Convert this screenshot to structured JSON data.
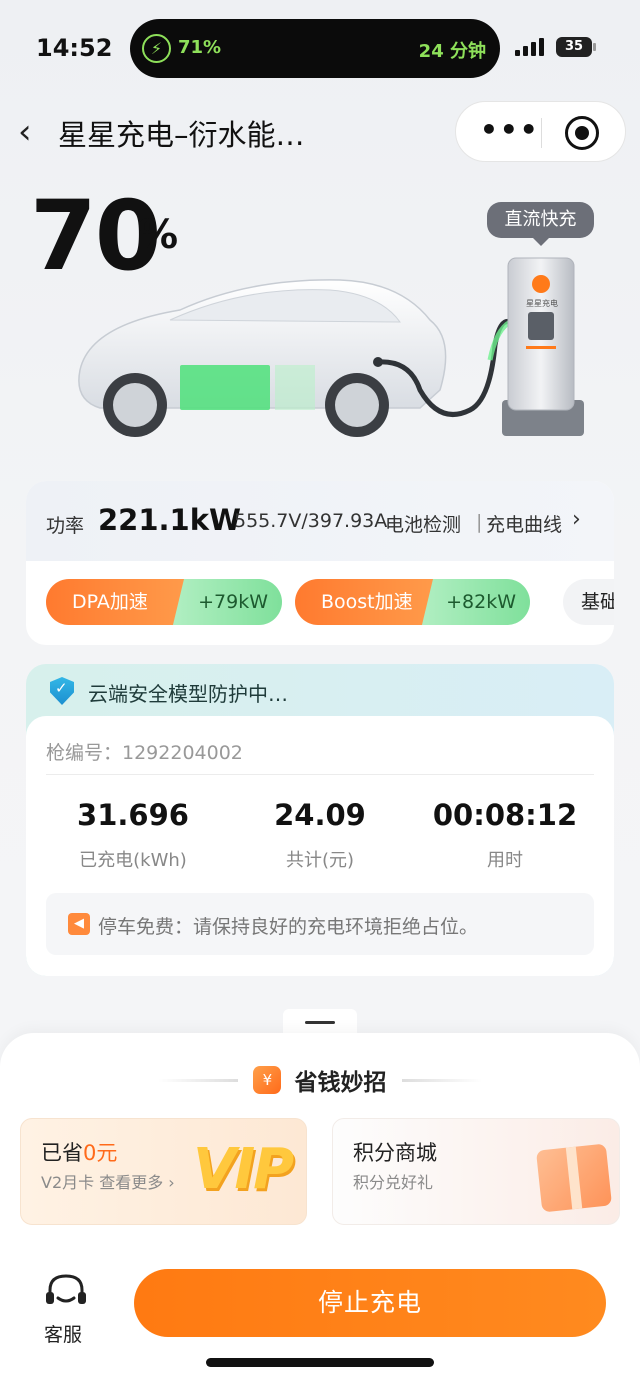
{
  "status_bar": {
    "time": "14:52",
    "charge_percent": "71%",
    "time_remaining": "24 分钟",
    "battery_level": "35"
  },
  "nav": {
    "back_glyph": "‹",
    "title": "星星充电–衍水能…",
    "more_glyph": "•••"
  },
  "hero": {
    "percent_value": "70",
    "percent_sign": "%",
    "charger_badge": "直流快充",
    "charger_brand": "星星充电"
  },
  "power": {
    "label": "功率",
    "value": "221.1kW",
    "voltage_current": "555.7V/397.93A",
    "battery_check": "电池检测",
    "divider": "|",
    "curve_link": "充电曲线",
    "chevron": "›"
  },
  "boosts": [
    {
      "name": "DPA加速",
      "gain": "+79kW"
    },
    {
      "name": "Boost加速",
      "gain": "+82kW"
    },
    {
      "name": "基础"
    }
  ],
  "security": {
    "text": "云端安全模型防护中…"
  },
  "session": {
    "gun_number": "枪编号：1292204002",
    "stats": [
      {
        "value": "31.696",
        "label": "已充电(kWh)"
      },
      {
        "value": "24.09",
        "label": "共计(元)"
      },
      {
        "value": "00:08:12",
        "label": "用时"
      }
    ],
    "notice": "停车免费：请保持良好的充电环境拒绝占位。"
  },
  "money_tips": {
    "title": "省钱妙招",
    "vip_card": {
      "saved_prefix": "已省",
      "saved_amount": "0元",
      "subtitle": "V2月卡 查看更多 ›",
      "badge": "VIP"
    },
    "mall_card": {
      "title": "积分商城",
      "subtitle": "积分兑好礼"
    }
  },
  "bottom": {
    "service_label": "客服",
    "stop_button": "停止充电"
  },
  "colors": {
    "accent_orange": "#ff7a12",
    "boost_green": "#7fe09b",
    "charge_green": "#8ee05a"
  }
}
